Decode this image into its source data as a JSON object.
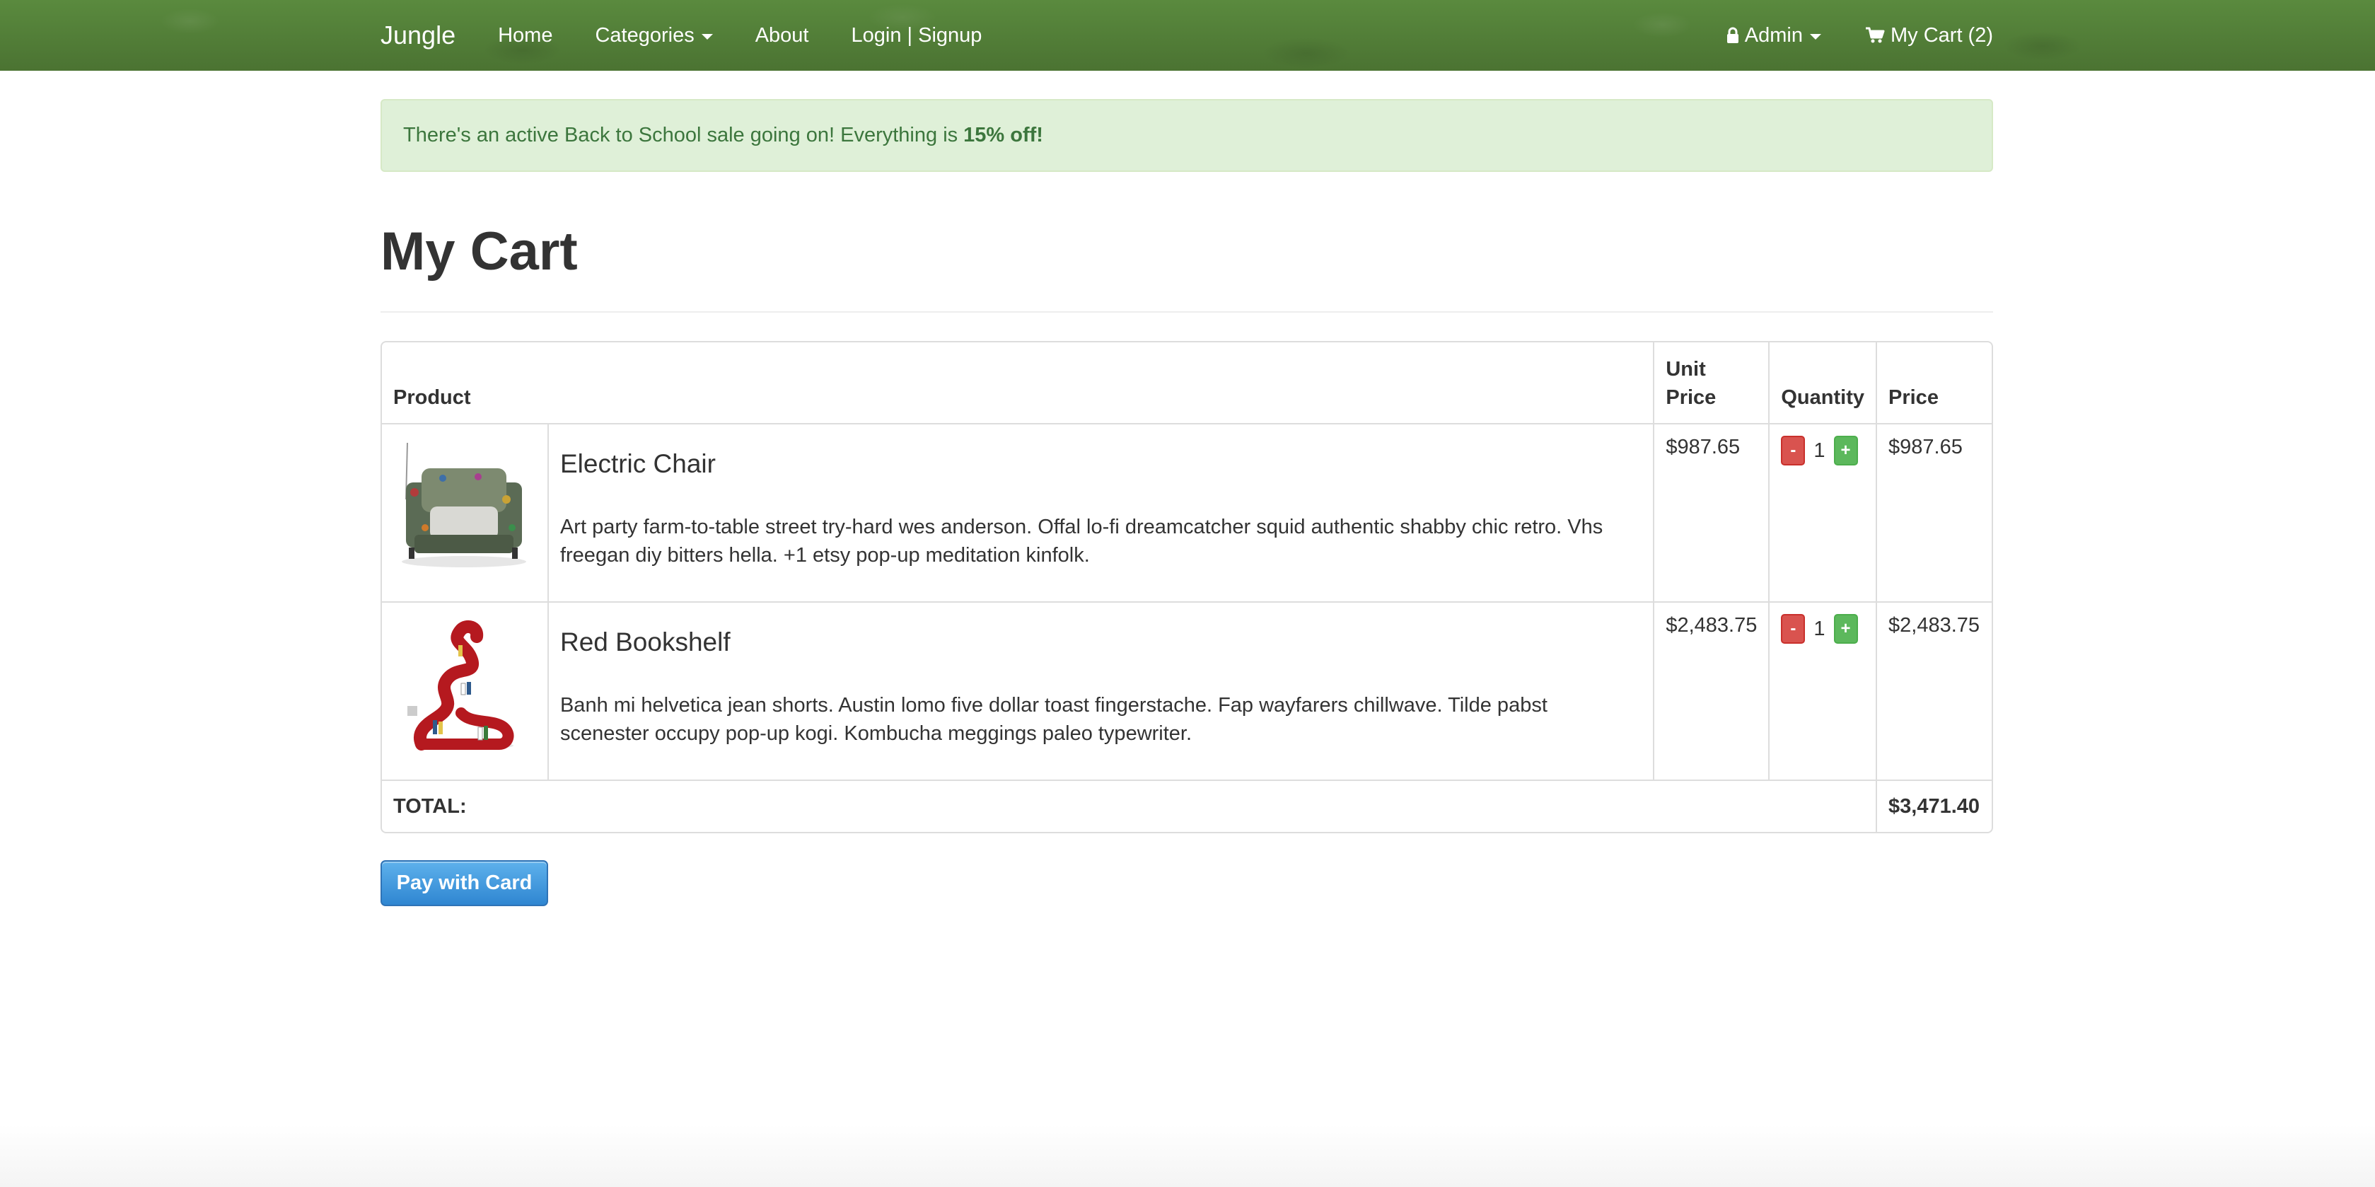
{
  "navbar": {
    "brand": "Jungle",
    "links": {
      "home": "Home",
      "categories": "Categories",
      "about": "About",
      "login": "Login | Signup"
    },
    "admin": "Admin",
    "cart": "My Cart (2)",
    "colors": {
      "background": "#4f7a36",
      "text": "#ffffff"
    }
  },
  "alert": {
    "text": "There's an active Back to School sale going on! Everything is",
    "highlight": "15% off!"
  },
  "page": {
    "title": "My Cart"
  },
  "table": {
    "headers": {
      "product": "Product",
      "unit_price": "Unit Price",
      "quantity": "Quantity",
      "price": "Price"
    },
    "rows": [
      {
        "name": "Electric Chair",
        "description": "Art party farm-to-table street try-hard wes anderson. Offal lo-fi dreamcatcher squid authentic shabby chic retro. Vhs freegan diy bitters hella. +1 etsy pop-up meditation kinfolk.",
        "unit_price": "$987.65",
        "quantity": "1",
        "price": "$987.65",
        "minus": "-",
        "plus": "+"
      },
      {
        "name": "Red Bookshelf",
        "description": "Banh mi helvetica jean shorts. Austin lomo five dollar toast fingerstache. Fap wayfarers chillwave. Tilde pabst scenester occupy pop-up kogi. Kombucha meggings paleo typewriter.",
        "unit_price": "$2,483.75",
        "quantity": "1",
        "price": "$2,483.75",
        "minus": "-",
        "plus": "+"
      }
    ],
    "total_label": "TOTAL:",
    "total_value": "$3,471.40"
  },
  "pay_button": {
    "label": "Pay with Card",
    "color": "#2f86d1"
  }
}
